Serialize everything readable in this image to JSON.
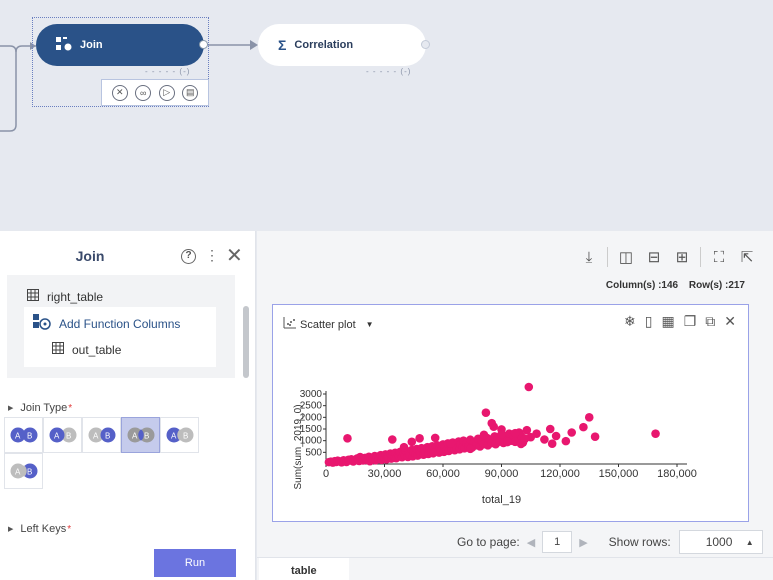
{
  "canvas": {
    "nodes": {
      "join": {
        "name": "Join",
        "status": "- - - - - (-)"
      },
      "correlation": {
        "name": "Correlation",
        "status": "- - - - - (-)"
      }
    }
  },
  "left_panel": {
    "title": "Join",
    "help_icon": "?",
    "more_icon": "⋮",
    "close_icon": "✕",
    "tree": {
      "input_table": "right_table",
      "function": "Add Function Columns",
      "output_table": "out_table"
    },
    "join_type": {
      "label": "Join Type",
      "required": "*"
    },
    "left_keys": {
      "label": "Left Keys",
      "required": "*"
    },
    "run_label": "Run"
  },
  "right_panel": {
    "stats": {
      "columns": "Column(s) :146",
      "rows": "Row(s) :217"
    },
    "chart_type_label": "Scatter plot",
    "pager": {
      "go_to_label": "Go to page:",
      "page": "1",
      "show_rows_label": "Show rows:",
      "rows_value": "1000"
    },
    "tab_label": "table"
  },
  "chart_data": {
    "type": "scatter",
    "xlabel": "total_19",
    "ylabel": "Sum(sum_2019_0)",
    "x_ticks": [
      "0",
      "30,000",
      "60,000",
      "90,000",
      "120,000",
      "150,000",
      "180,000"
    ],
    "y_ticks": [
      "500",
      "1000",
      "1500",
      "2000",
      "2500",
      "3000"
    ],
    "xlim": [
      0,
      180000
    ],
    "ylim": [
      0,
      3000
    ],
    "color": "#e8176f",
    "points": [
      [
        1500,
        80
      ],
      [
        2500,
        100
      ],
      [
        3500,
        60
      ],
      [
        4500,
        120
      ],
      [
        5200,
        90
      ],
      [
        6000,
        140
      ],
      [
        7000,
        110
      ],
      [
        8000,
        70
      ],
      [
        9000,
        160
      ],
      [
        9800,
        130
      ],
      [
        10500,
        90
      ],
      [
        11500,
        180
      ],
      [
        12500,
        150
      ],
      [
        13000,
        200
      ],
      [
        14000,
        110
      ],
      [
        15000,
        170
      ],
      [
        16000,
        240
      ],
      [
        17000,
        130
      ],
      [
        17500,
        300
      ],
      [
        18000,
        190
      ],
      [
        19000,
        150
      ],
      [
        20000,
        260
      ],
      [
        20500,
        210
      ],
      [
        21000,
        170
      ],
      [
        22000,
        310
      ],
      [
        22500,
        120
      ],
      [
        23000,
        250
      ],
      [
        24000,
        200
      ],
      [
        25000,
        340
      ],
      [
        25500,
        160
      ],
      [
        26000,
        280
      ],
      [
        27000,
        230
      ],
      [
        28000,
        380
      ],
      [
        28500,
        180
      ],
      [
        29000,
        300
      ],
      [
        30000,
        260
      ],
      [
        30500,
        410
      ],
      [
        31000,
        200
      ],
      [
        31500,
        330
      ],
      [
        32000,
        280
      ],
      [
        33000,
        450
      ],
      [
        33500,
        230
      ],
      [
        34000,
        360
      ],
      [
        35000,
        310
      ],
      [
        35500,
        480
      ],
      [
        36000,
        250
      ],
      [
        37000,
        400
      ],
      [
        37500,
        330
      ],
      [
        38000,
        520
      ],
      [
        39000,
        290
      ],
      [
        40000,
        430
      ],
      [
        40500,
        360
      ],
      [
        41000,
        560
      ],
      [
        42000,
        300
      ],
      [
        42500,
        470
      ],
      [
        43000,
        390
      ],
      [
        44000,
        600
      ],
      [
        44500,
        330
      ],
      [
        45000,
        500
      ],
      [
        46000,
        420
      ],
      [
        46500,
        640
      ],
      [
        47000,
        360
      ],
      [
        48000,
        540
      ],
      [
        48500,
        450
      ],
      [
        49000,
        680
      ],
      [
        50000,
        400
      ],
      [
        50500,
        570
      ],
      [
        51000,
        480
      ],
      [
        52000,
        720
      ],
      [
        52500,
        430
      ],
      [
        53000,
        610
      ],
      [
        54000,
        510
      ],
      [
        54500,
        760
      ],
      [
        55000,
        460
      ],
      [
        56000,
        650
      ],
      [
        56500,
        540
      ],
      [
        57000,
        800
      ],
      [
        58000,
        490
      ],
      [
        58500,
        690
      ],
      [
        59000,
        570
      ],
      [
        60000,
        840
      ],
      [
        60500,
        520
      ],
      [
        61000,
        730
      ],
      [
        62000,
        600
      ],
      [
        62500,
        880
      ],
      [
        63000,
        560
      ],
      [
        64000,
        770
      ],
      [
        64500,
        640
      ],
      [
        65000,
        920
      ],
      [
        66000,
        590
      ],
      [
        66500,
        810
      ],
      [
        67000,
        680
      ],
      [
        68000,
        960
      ],
      [
        68500,
        630
      ],
      [
        69000,
        850
      ],
      [
        70000,
        720
      ],
      [
        70500,
        1000
      ],
      [
        71000,
        670
      ],
      [
        72000,
        890
      ],
      [
        73000,
        760
      ],
      [
        74000,
        1040
      ],
      [
        75000,
        710
      ],
      [
        76000,
        940
      ],
      [
        77000,
        800
      ],
      [
        78000,
        1080
      ],
      [
        79000,
        750
      ],
      [
        80000,
        990
      ],
      [
        81000,
        850
      ],
      [
        82000,
        2200
      ],
      [
        82500,
        1120
      ],
      [
        83000,
        800
      ],
      [
        84000,
        1050
      ],
      [
        85000,
        900
      ],
      [
        86000,
        1600
      ],
      [
        86500,
        1180
      ],
      [
        87000,
        850
      ],
      [
        88000,
        1110
      ],
      [
        89000,
        960
      ],
      [
        90000,
        1480
      ],
      [
        90500,
        1240
      ],
      [
        91000,
        900
      ],
      [
        92000,
        1170
      ],
      [
        93000,
        1020
      ],
      [
        94000,
        1300
      ],
      [
        95000,
        1000
      ],
      [
        96000,
        1240
      ],
      [
        97000,
        950
      ],
      [
        98000,
        1100
      ],
      [
        99000,
        1350
      ],
      [
        100000,
        1200
      ],
      [
        101000,
        920
      ],
      [
        103000,
        1450
      ],
      [
        104000,
        3300
      ],
      [
        105000,
        1150
      ],
      [
        108000,
        1300
      ],
      [
        112000,
        1050
      ],
      [
        115000,
        1500
      ],
      [
        116000,
        870
      ],
      [
        118000,
        1200
      ],
      [
        123000,
        980
      ],
      [
        126000,
        1350
      ],
      [
        132000,
        1580
      ],
      [
        135000,
        2000
      ],
      [
        138000,
        1170
      ],
      [
        169000,
        1300
      ],
      [
        11000,
        1100
      ],
      [
        34000,
        1050
      ],
      [
        40000,
        720
      ],
      [
        48000,
        1100
      ],
      [
        64000,
        880
      ],
      [
        74000,
        650
      ],
      [
        81000,
        1250
      ],
      [
        85000,
        1750
      ],
      [
        90000,
        1270
      ],
      [
        93000,
        940
      ],
      [
        97000,
        1320
      ],
      [
        100000,
        860
      ],
      [
        102000,
        1080
      ],
      [
        44000,
        950
      ],
      [
        56000,
        1120
      ]
    ]
  }
}
